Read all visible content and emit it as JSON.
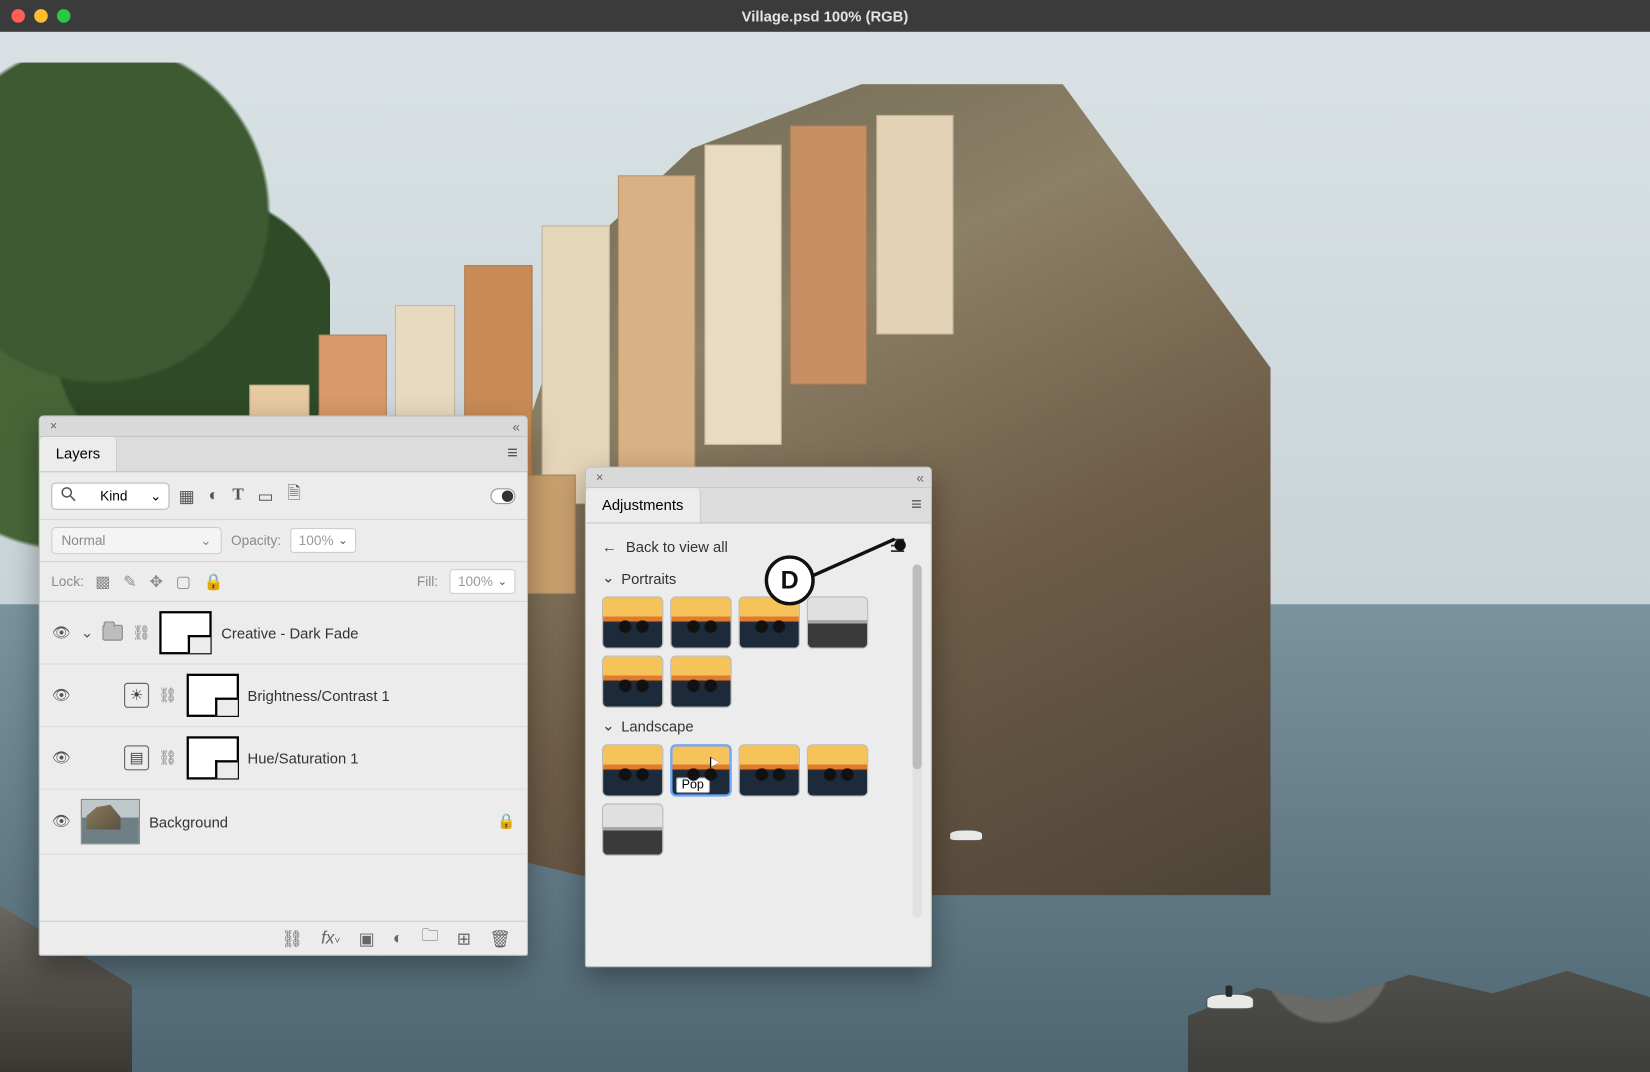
{
  "window": {
    "title": "Village.psd 100% (RGB)"
  },
  "layers_panel": {
    "tab": "Layers",
    "filter_label": "Kind",
    "blend_mode": "Normal",
    "opacity_label": "Opacity:",
    "opacity_value": "100%",
    "lock_label": "Lock:",
    "fill_label": "Fill:",
    "fill_value": "100%",
    "layers": [
      {
        "name": "Creative - Dark Fade",
        "type": "group"
      },
      {
        "name": "Brightness/Contrast 1",
        "type": "adjustment"
      },
      {
        "name": "Hue/Saturation 1",
        "type": "adjustment"
      },
      {
        "name": "Background",
        "type": "image",
        "locked": true
      }
    ]
  },
  "adjustments_panel": {
    "tab": "Adjustments",
    "back_label": "Back to view all",
    "sections": [
      {
        "title": "Portraits",
        "count": 6
      },
      {
        "title": "Landscape",
        "count": 5
      }
    ],
    "tooltip": "Pop"
  },
  "callout": {
    "label": "D"
  }
}
